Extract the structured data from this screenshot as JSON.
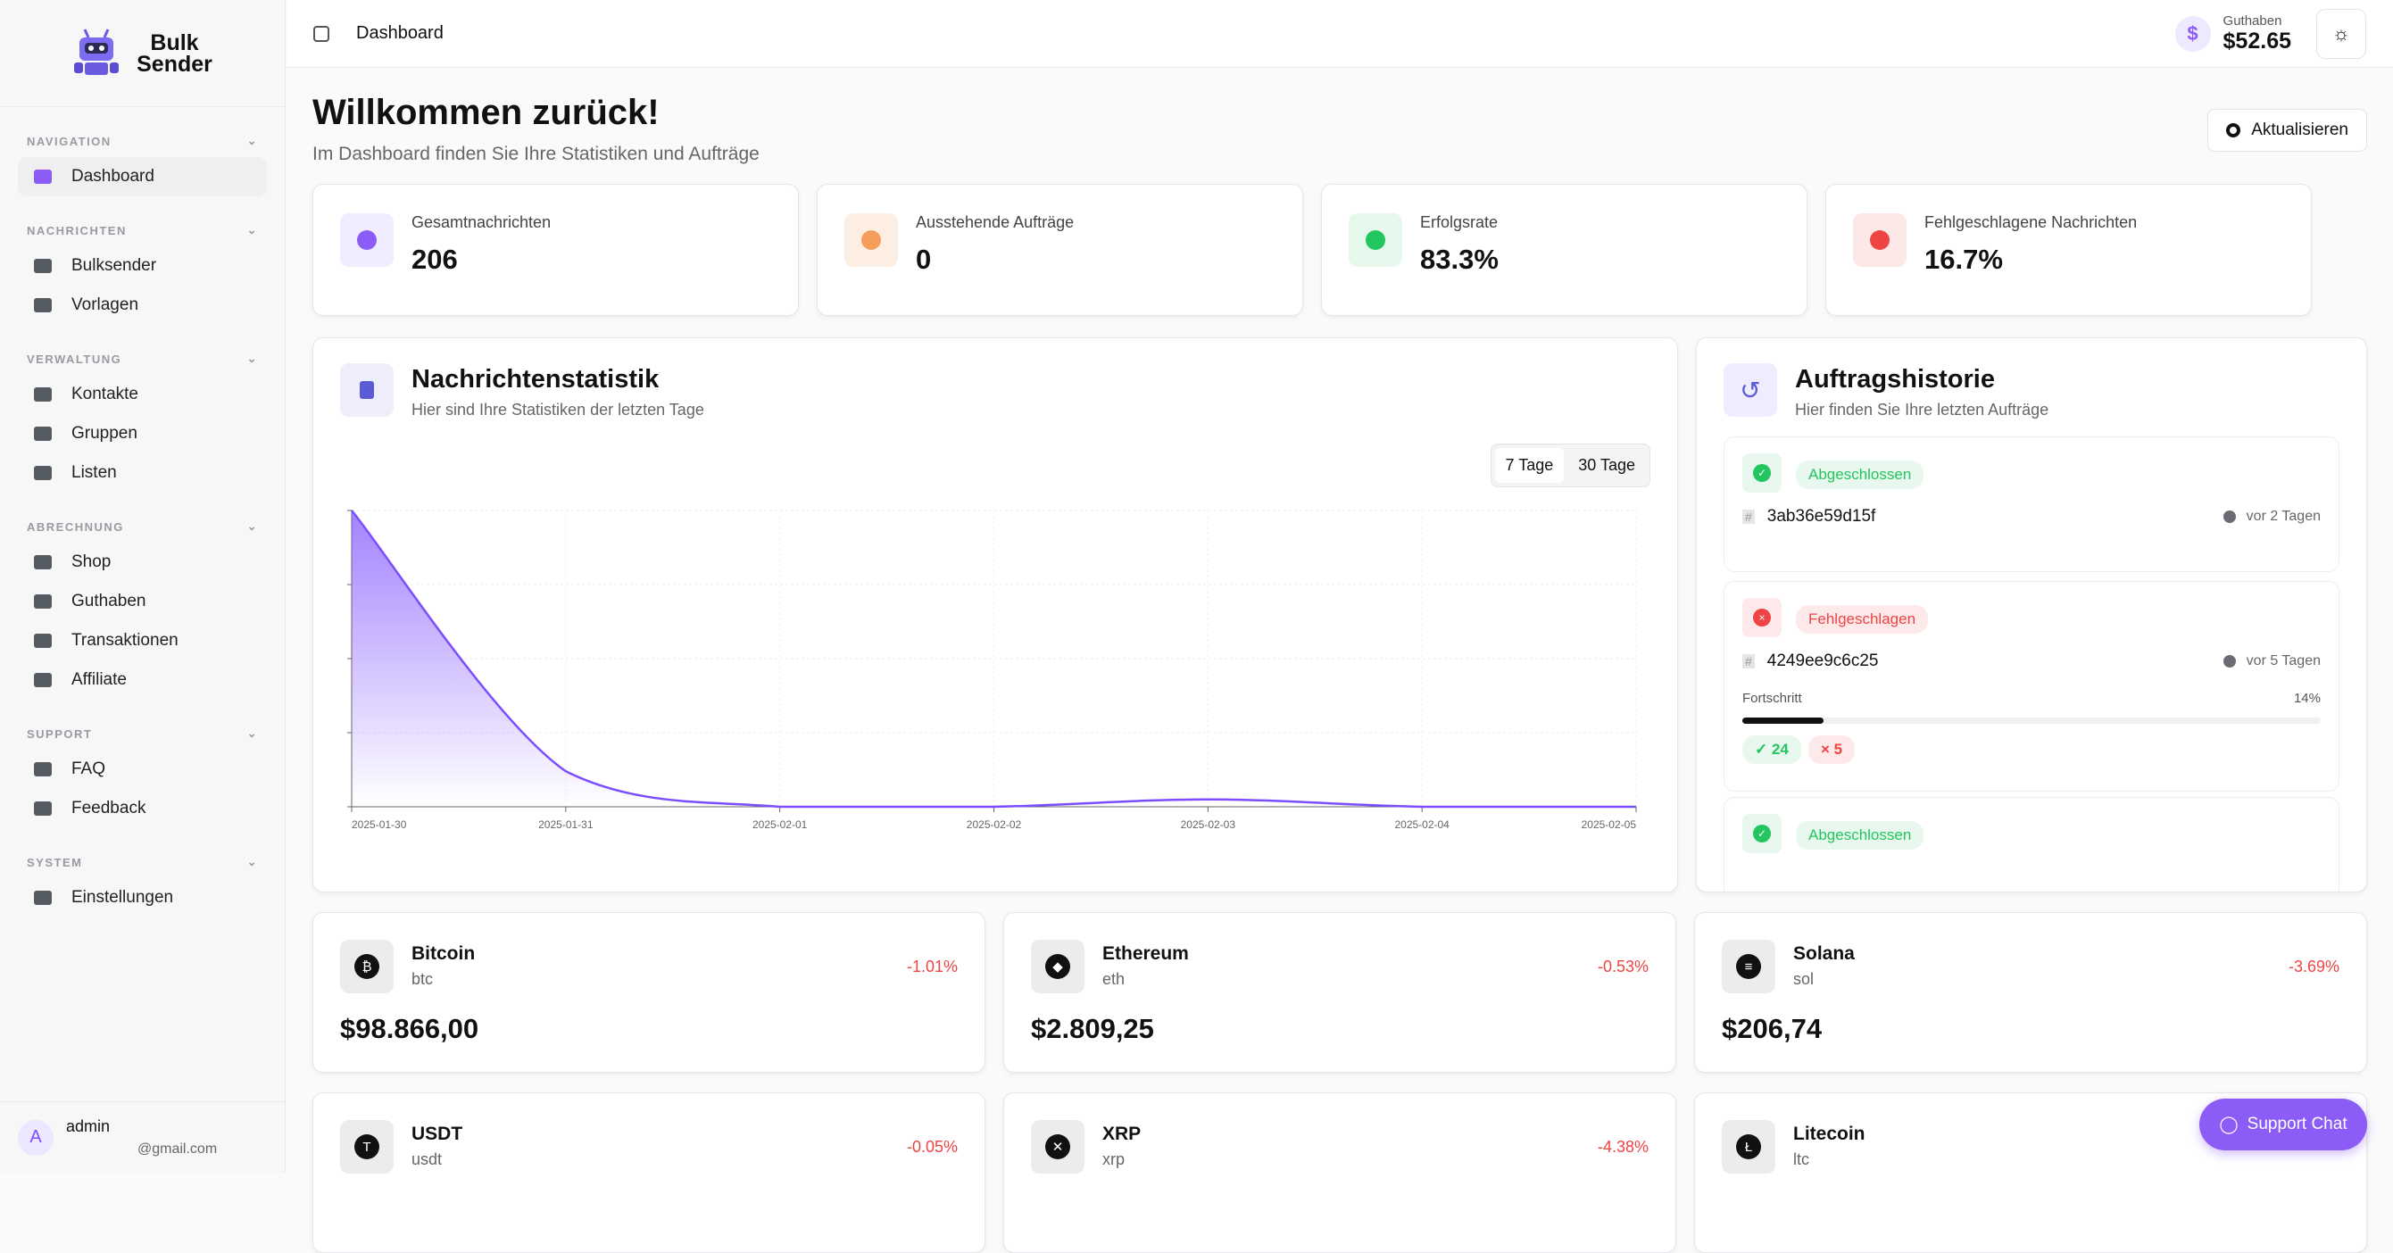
{
  "app": {
    "name_line1": "Bulk",
    "name_line2": "Sender"
  },
  "sidebar": {
    "sections": [
      {
        "title": "NAVIGATION",
        "items": [
          {
            "label": "Dashboard",
            "icon": "grid-icon",
            "active": true
          }
        ]
      },
      {
        "title": "NACHRICHTEN",
        "items": [
          {
            "label": "Bulksender",
            "icon": "chat-icon"
          },
          {
            "label": "Vorlagen",
            "icon": "file-icon"
          }
        ]
      },
      {
        "title": "VERWALTUNG",
        "items": [
          {
            "label": "Kontakte",
            "icon": "users-icon"
          },
          {
            "label": "Gruppen",
            "icon": "group-icon"
          },
          {
            "label": "Listen",
            "icon": "list-icon"
          }
        ]
      },
      {
        "title": "ABRECHNUNG",
        "items": [
          {
            "label": "Shop",
            "icon": "cart-icon"
          },
          {
            "label": "Guthaben",
            "icon": "wallet-icon"
          },
          {
            "label": "Transaktionen",
            "icon": "card-icon"
          },
          {
            "label": "Affiliate",
            "icon": "ticket-icon"
          }
        ]
      },
      {
        "title": "SUPPORT",
        "items": [
          {
            "label": "FAQ",
            "icon": "question-icon"
          },
          {
            "label": "Feedback",
            "icon": "chat-icon"
          }
        ]
      },
      {
        "title": "SYSTEM",
        "items": [
          {
            "label": "Einstellungen",
            "icon": "gear-icon"
          }
        ]
      }
    ],
    "user": {
      "initial": "A",
      "name": "admin",
      "email": "@gmail.com"
    }
  },
  "header": {
    "title": "Dashboard",
    "balance_label": "Guthaben",
    "balance": "$52.65"
  },
  "welcome": {
    "title": "Willkommen zurück!",
    "subtitle": "Im Dashboard finden Sie Ihre Statistiken und Aufträge",
    "refresh": "Aktualisieren"
  },
  "stats": [
    {
      "label": "Gesamtnachrichten",
      "value": "206",
      "color": "#8b5cf6",
      "bg": "#f1ecff"
    },
    {
      "label": "Ausstehende Aufträge",
      "value": "0",
      "color": "#f59e5b",
      "bg": "#fdeee4"
    },
    {
      "label": "Erfolgsrate",
      "value": "83.3%",
      "color": "#22c55e",
      "bg": "#e6f8ec"
    },
    {
      "label": "Fehlgeschlagene Nachrichten",
      "value": "16.7%",
      "color": "#ef4444",
      "bg": "#fde8e8"
    }
  ],
  "chart_card": {
    "title": "Nachrichtenstatistik",
    "subtitle": "Hier sind Ihre Statistiken der letzten Tage",
    "ranges": [
      "7 Tage",
      "30 Tage"
    ],
    "selected": "7 Tage"
  },
  "chart_data": {
    "type": "area",
    "x": [
      "2025-01-30",
      "2025-01-31",
      "2025-02-01",
      "2025-02-02",
      "2025-02-03",
      "2025-02-04",
      "2025-02-05"
    ],
    "values": [
      200,
      24,
      0,
      0,
      5,
      0,
      0
    ],
    "ylim": [
      0,
      200
    ],
    "grid": true,
    "color": "#7c4dff"
  },
  "history": {
    "title": "Auftragshistorie",
    "subtitle": "Hier finden Sie Ihre letzten Aufträge",
    "orders": [
      {
        "status": "Abgeschlossen",
        "type": "success",
        "id": "3ab36e59d15f",
        "time": "vor 2 Tagen"
      },
      {
        "status": "Fehlgeschlagen",
        "type": "error",
        "id": "4249ee9c6c25",
        "time": "vor 5 Tagen",
        "progress_label": "Fortschritt",
        "progress": "14%",
        "success": "24",
        "failed": "5"
      },
      {
        "status": "Abgeschlossen",
        "type": "success"
      }
    ]
  },
  "crypto": [
    {
      "name": "Bitcoin",
      "sym": "btc",
      "change": "-1.01%",
      "price": "$98.866,00",
      "glyph": "₿"
    },
    {
      "name": "Ethereum",
      "sym": "eth",
      "change": "-0.53%",
      "price": "$2.809,25",
      "glyph": "◆"
    },
    {
      "name": "Solana",
      "sym": "sol",
      "change": "-3.69%",
      "price": "$206,74",
      "glyph": "≡"
    },
    {
      "name": "USDT",
      "sym": "usdt",
      "change": "-0.05%",
      "glyph": "T"
    },
    {
      "name": "XRP",
      "sym": "xrp",
      "change": "-4.38%",
      "glyph": "✕"
    },
    {
      "name": "Litecoin",
      "sym": "ltc",
      "glyph": "Ł"
    }
  ],
  "support_chat": "Support Chat"
}
